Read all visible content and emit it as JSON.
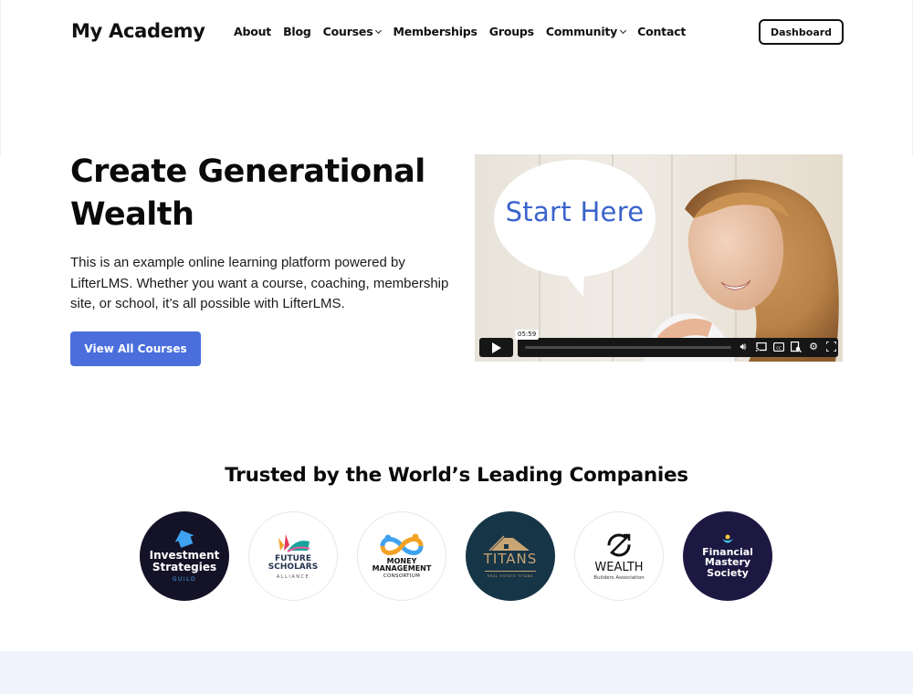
{
  "header": {
    "site_title": "My Academy",
    "nav": [
      {
        "label": "About",
        "has_dropdown": false
      },
      {
        "label": "Blog",
        "has_dropdown": false
      },
      {
        "label": "Courses",
        "has_dropdown": true
      },
      {
        "label": "Memberships",
        "has_dropdown": false
      },
      {
        "label": "Groups",
        "has_dropdown": false
      },
      {
        "label": "Community",
        "has_dropdown": true
      },
      {
        "label": "Contact",
        "has_dropdown": false
      }
    ],
    "dashboard_label": "Dashboard"
  },
  "hero": {
    "title": "Create Generational Wealth",
    "description": "This is an example online learning platform powered by LifterLMS. Whether you want a course, coaching, membership site, or school, it’s all possible with LifterLMS.",
    "cta_label": "View All Courses",
    "accent_color": "#4a6fdc"
  },
  "video": {
    "overlay_text": "Start Here",
    "duration": "05:59",
    "controls": [
      "play-icon",
      "volume-icon",
      "cast-icon",
      "captions-icon",
      "transcript-icon",
      "settings-icon",
      "fullscreen-icon"
    ]
  },
  "trusted": {
    "title": "Trusted by the World’s Leading Companies",
    "logos": [
      {
        "name": "Investment Strategies",
        "sub": "GUILD"
      },
      {
        "name": "FUTURE SCHOLARS",
        "sub": "ALLIANCE"
      },
      {
        "name": "MONEY MANAGEMENT",
        "sub": "CONSORTIUM"
      },
      {
        "name": "TITANS",
        "sub": "REAL ESTATE TITANS"
      },
      {
        "name": "WEALTH",
        "sub": "Builders Association"
      },
      {
        "name": "Financial Mastery Society",
        "sub": ""
      }
    ]
  }
}
